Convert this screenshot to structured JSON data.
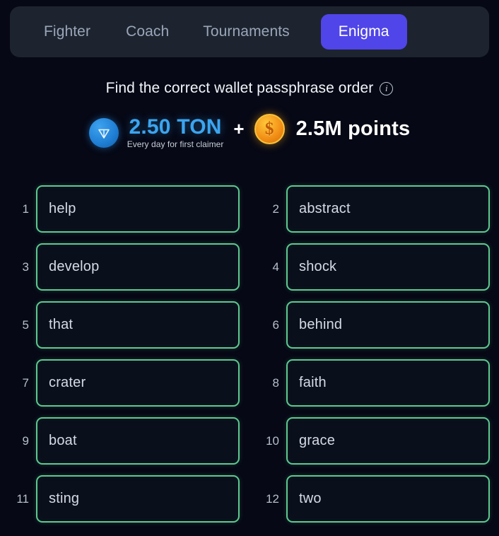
{
  "colors": {
    "background": "#060815",
    "navbar_bg": "#1d2430",
    "accent_active": "#5045e8",
    "card_border": "#5ec98f",
    "card_bg": "#0a0f1c",
    "ton_blue": "#3ba5f0",
    "coin_gold": "#f3a018",
    "nav_inactive_text": "#9aa6b8"
  },
  "navbar": {
    "items": [
      {
        "label": "Fighter",
        "active": false
      },
      {
        "label": "Coach",
        "active": false
      },
      {
        "label": "Tournaments",
        "active": false
      },
      {
        "label": "Enigma",
        "active": true
      }
    ]
  },
  "header": {
    "title": "Find the correct wallet passphrase order",
    "info_icon": "info-circle-icon",
    "info_glyph": "i"
  },
  "reward": {
    "ton_icon": "ton-coin-icon",
    "ton_amount": "2.50 TON",
    "ton_subtitle": "Every day for first claimer",
    "plus": "+",
    "coin_icon": "gold-coin-icon",
    "coin_glyph": "$",
    "points_amount": "2.5M points"
  },
  "passphrase": {
    "words": [
      {
        "index": "1",
        "word": "help"
      },
      {
        "index": "2",
        "word": "abstract"
      },
      {
        "index": "3",
        "word": "develop"
      },
      {
        "index": "4",
        "word": "shock"
      },
      {
        "index": "5",
        "word": "that"
      },
      {
        "index": "6",
        "word": "behind"
      },
      {
        "index": "7",
        "word": "crater"
      },
      {
        "index": "8",
        "word": "faith"
      },
      {
        "index": "9",
        "word": "boat"
      },
      {
        "index": "10",
        "word": "grace"
      },
      {
        "index": "11",
        "word": "sting"
      },
      {
        "index": "12",
        "word": "two"
      }
    ]
  }
}
